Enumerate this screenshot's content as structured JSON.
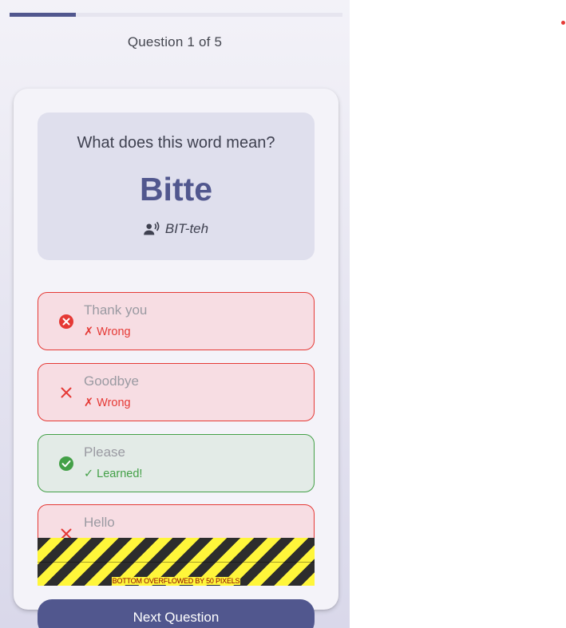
{
  "progress": {
    "current": 1,
    "total": 5,
    "fraction": 0.2
  },
  "header": {
    "counter": "Question 1 of 5"
  },
  "question": {
    "prompt": "What does this word mean?",
    "word": "Bitte",
    "pronunciation": "BIT-teh",
    "pronunciation_icon": "record-voice-icon"
  },
  "options": [
    {
      "label": "Thank you",
      "status": "✗ Wrong",
      "state": "wrong",
      "icon": "cancel-circle-icon"
    },
    {
      "label": "Goodbye",
      "status": "✗ Wrong",
      "state": "wrong",
      "icon": "close-icon"
    },
    {
      "label": "Please",
      "status": "✓ Learned!",
      "state": "correct",
      "icon": "check-circle-icon"
    },
    {
      "label": "Hello",
      "status": "",
      "state": "wrong",
      "icon": "close-icon"
    }
  ],
  "overflow_warning": "BOTTOM OVERFLOWED BY 50 PIXELS",
  "actions": {
    "next_label": "Next Question"
  },
  "colors": {
    "primary": "#51578e",
    "wrong": "#e53935",
    "correct": "#43a047",
    "wrong_bg": "#f7dde3",
    "correct_bg": "#e3ebe7"
  }
}
